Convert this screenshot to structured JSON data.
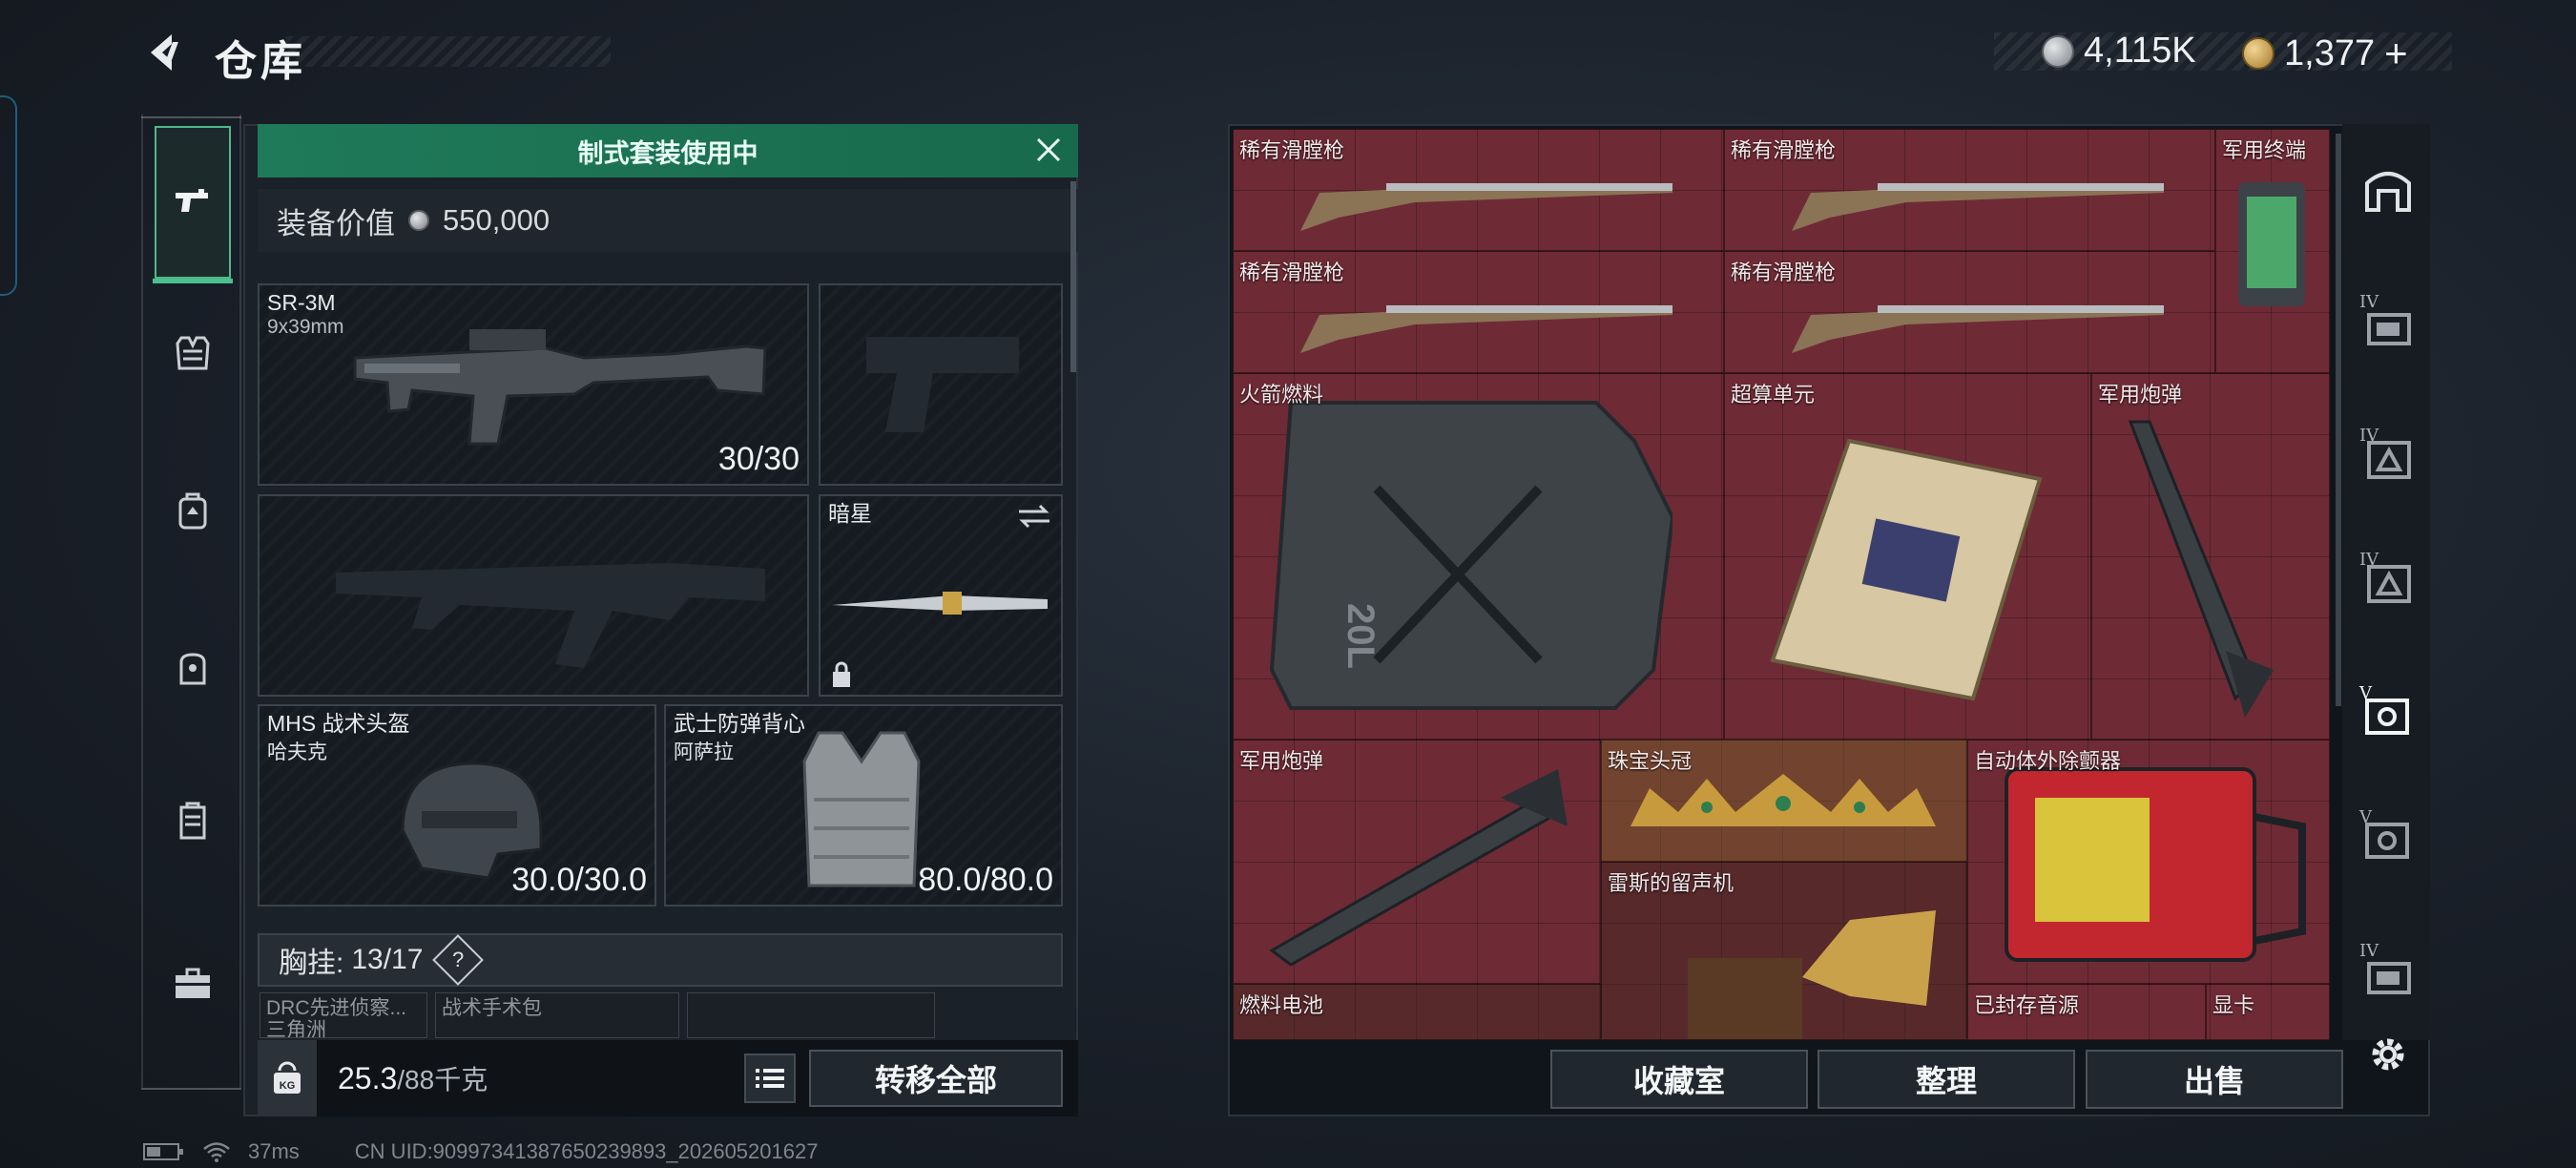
{
  "header": {
    "title": "仓库",
    "currency_silver": "4,115K",
    "currency_gold": "1,377",
    "currency_gold_plus": "+"
  },
  "left_rail": {
    "items": [
      {
        "icon": "pistol-icon",
        "active": true
      },
      {
        "icon": "armor-vest-icon",
        "active": false
      },
      {
        "icon": "backpack-icon",
        "active": false
      },
      {
        "icon": "helmet-bag-icon",
        "active": false
      },
      {
        "icon": "case-icon",
        "active": false
      },
      {
        "icon": "toolbox-icon",
        "active": false
      }
    ]
  },
  "loadout": {
    "preset_banner": "制式套装使用中",
    "equip_value_label": "装备价值",
    "equip_value": "550,000",
    "primary_weapon": {
      "name": "SR-3M",
      "ammo_type": "9x39mm",
      "ammo": "30/30"
    },
    "secondary_weapon": {
      "name": ""
    },
    "melee": {
      "name": "暗星"
    },
    "helmet": {
      "name": "MHS 战术头盔",
      "sub": "哈夫克",
      "durability": "30.0/30.0"
    },
    "armor": {
      "name": "武士防弹背心",
      "sub": "阿萨拉",
      "durability": "80.0/80.0"
    },
    "chest_rig_label": "胸挂:",
    "chest_rig_capacity": "13/17",
    "chest_rig_help": "?",
    "mini_slots": [
      "DRC先进侦察...",
      "战术手术包",
      ""
    ],
    "mini_slot_sub": "三角洲",
    "weight_current": "25.3",
    "weight_max": "/88千克",
    "weight_icon_label": "KG",
    "transfer_all": "转移全部"
  },
  "stash": {
    "items": [
      {
        "label": "稀有滑膛枪",
        "kind": "musket"
      },
      {
        "label": "稀有滑膛枪",
        "kind": "musket"
      },
      {
        "label": "军用终端",
        "kind": "terminal"
      },
      {
        "label": "稀有滑膛枪",
        "kind": "musket"
      },
      {
        "label": "稀有滑膛枪",
        "kind": "musket"
      },
      {
        "label": "火箭燃料",
        "kind": "jerrycan"
      },
      {
        "label": "超算单元",
        "kind": "board"
      },
      {
        "label": "军用炮弹",
        "kind": "missile"
      },
      {
        "label": "军用炮弹",
        "kind": "missile"
      },
      {
        "label": "珠宝头冠",
        "kind": "crown"
      },
      {
        "label": "自动体外除颤器",
        "kind": "aed"
      },
      {
        "label": "雷斯的留声机",
        "kind": "gramophone"
      },
      {
        "label": "燃料电池",
        "kind": "cell"
      },
      {
        "label": "已封存音源",
        "kind": "tape"
      },
      {
        "label": "显卡",
        "kind": "gpu"
      }
    ],
    "jerrycan_text": "20L",
    "buttons": {
      "collection": "收藏室",
      "organize": "整理",
      "sell": "出售"
    },
    "right_rail_roman": [
      "IV",
      "IV",
      "IV",
      "V",
      "V",
      "IV"
    ]
  },
  "statusbar": {
    "ping": "37ms",
    "uid": "CN UID:90997341387650239893_202605201627"
  },
  "colors": {
    "accent_green": "#1f7a5a",
    "stash_red": "#6e2b35",
    "background": "#1a2029"
  }
}
